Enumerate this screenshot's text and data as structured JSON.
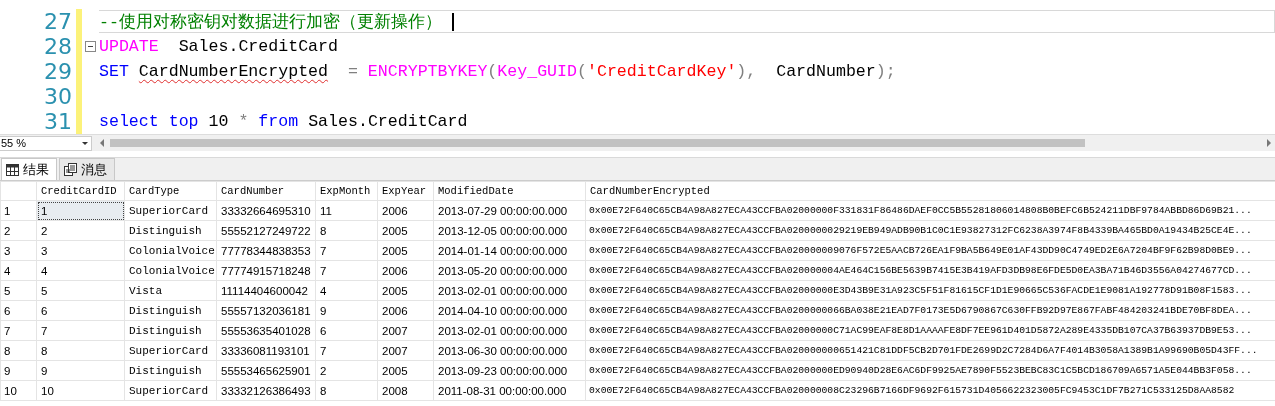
{
  "editor": {
    "lines": [
      {
        "number": "27",
        "current": true,
        "collapsible": false,
        "tokens": [
          {
            "kind": "comment",
            "text": "--使用对称密钥对数据进行加密（更新操作）"
          }
        ]
      },
      {
        "number": "28",
        "current": false,
        "collapsible": true,
        "tokens": [
          {
            "kind": "function",
            "text": "UPDATE"
          },
          {
            "kind": "plain",
            "text": " Sales.CreditCard"
          }
        ]
      },
      {
        "number": "29",
        "current": false,
        "collapsible": false,
        "tokens": [
          {
            "kind": "keyword",
            "text": "SET"
          },
          {
            "kind": "error",
            "text": "CardNumberEncrypted"
          },
          {
            "kind": "operator",
            "text": " = "
          },
          {
            "kind": "function",
            "text": "ENCRYPTBYKEY"
          },
          {
            "kind": "operator",
            "text": "("
          },
          {
            "kind": "function",
            "text": "Key_GUID"
          },
          {
            "kind": "operator",
            "text": "("
          },
          {
            "kind": "string",
            "text": "'CreditCardKey'"
          },
          {
            "kind": "operator",
            "text": "),"
          },
          {
            "kind": "plain",
            "text": " CardNumber"
          },
          {
            "kind": "operator",
            "text": ");"
          }
        ]
      },
      {
        "number": "30",
        "current": false,
        "collapsible": false
      },
      {
        "number": "31",
        "current": false,
        "collapsible": false,
        "tokens": [
          {
            "kind": "keyword",
            "text": "select top"
          },
          {
            "kind": "plain",
            "text": "10"
          },
          {
            "kind": "operator",
            "text": "*"
          },
          {
            "kind": "keyword",
            "text": "from"
          },
          {
            "kind": "plain",
            "text": "Sales.CreditCard"
          }
        ]
      }
    ]
  },
  "zoom": {
    "value": "55 %"
  },
  "tabs": [
    {
      "label": "结果",
      "kind": "grid",
      "selected": true
    },
    {
      "label": "消息",
      "kind": "messages",
      "selected": false
    }
  ],
  "grid": {
    "columns": [
      "CreditCardID",
      "CardType",
      "CardNumber",
      "ExpMonth",
      "ExpYear",
      "ModifiedDate",
      "CardNumberEncrypted"
    ],
    "rows": [
      {
        "number": "1",
        "selected": true,
        "cells": [
          "1",
          "SuperiorCard",
          "33332664695310",
          "11",
          "2006",
          "2013-07-29 00:00:00.000",
          "0x00E72F640C65CB4A98A827ECA43CCFBA02000000F331831F86486DAEF0CC5B55281806014808B0BEFC6B524211DBF9784ABBD86D69B21..."
        ]
      },
      {
        "number": "2",
        "selected": false,
        "cells": [
          "2",
          "Distinguish",
          "55552127249722",
          "8",
          "2005",
          "2013-12-05 00:00:00.000",
          "0x00E72F640C65CB4A98A827ECA43CCFBA0200000029219EB949ADB90B1C0C1E93827312FC6238A3974F8B4339BA465BD0A19434B25CE4E..."
        ]
      },
      {
        "number": "3",
        "selected": false,
        "cells": [
          "3",
          "ColonialVoice",
          "77778344838353",
          "7",
          "2005",
          "2014-01-14 00:00:00.000",
          "0x00E72F640C65CB4A98A827ECA43CCFBA020000009076F572E5AACB726EA1F9BA5B649E01AF43DD90C4749ED2E6A7204BF9F62B98D0BE9..."
        ]
      },
      {
        "number": "4",
        "selected": false,
        "cells": [
          "4",
          "ColonialVoice",
          "77774915718248",
          "7",
          "2006",
          "2013-05-20 00:00:00.000",
          "0x00E72F640C65CB4A98A827ECA43CCFBA020000004AE464C156BE5639B7415E3B419AFD3DB98E6FDE5D0EA3BA71B46D3556A04274677CD..."
        ]
      },
      {
        "number": "5",
        "selected": false,
        "cells": [
          "5",
          "Vista",
          "11114404600042",
          "4",
          "2005",
          "2013-02-01 00:00:00.000",
          "0x00E72F640C65CB4A98A827ECA43CCFBA02000000E3D43B9E31A923C5F51F81615CF1D1E90665C536FACDE1E9081A192778D91B08F1583..."
        ]
      },
      {
        "number": "6",
        "selected": false,
        "cells": [
          "6",
          "Distinguish",
          "55557132036181",
          "9",
          "2006",
          "2014-04-10 00:00:00.000",
          "0x00E72F640C65CB4A98A827ECA43CCFBA0200000066BA038E21EAD7F0173E5D6790867C630FFB92D97E867FABF484203241BDE70BF8DEA..."
        ]
      },
      {
        "number": "7",
        "selected": false,
        "cells": [
          "7",
          "Distinguish",
          "55553635401028",
          "6",
          "2007",
          "2013-02-01 00:00:00.000",
          "0x00E72F640C65CB4A98A827ECA43CCFBA02000000C71AC99EAF8E8D1AAAAFE8DF7EE961D401D5872A289E4335DB107CA37B63937DB9E53..."
        ]
      },
      {
        "number": "8",
        "selected": false,
        "cells": [
          "8",
          "SuperiorCard",
          "33336081193101",
          "7",
          "2007",
          "2013-06-30 00:00:00.000",
          "0x00E72F640C65CB4A98A827ECA43CCFBA020000000651421C81DDF5CB2D701FDE2699D2C7284D6A7F4014B3058A1389B1A99690B05D43FF..."
        ]
      },
      {
        "number": "9",
        "selected": false,
        "cells": [
          "9",
          "Distinguish",
          "55553465625901",
          "2",
          "2005",
          "2013-09-23 00:00:00.000",
          "0x00E72F640C65CB4A98A827ECA43CCFBA02000000ED90940D28E6AC6DF9925AE7890F5523BEBC83C1C5BCD186709A6571A5E044BB3F058..."
        ]
      },
      {
        "number": "10",
        "selected": false,
        "cells": [
          "10",
          "SuperiorCard",
          "33332126386493",
          "8",
          "2008",
          "2011-08-31 00:00:00.000",
          "0x00E72F640C65CB4A98A827ECA43CCFBA020000008C23296B7166DF9692F615731D4056622323005FC9453C1DF7B271C533125D8AA8582"
        ]
      }
    ]
  }
}
